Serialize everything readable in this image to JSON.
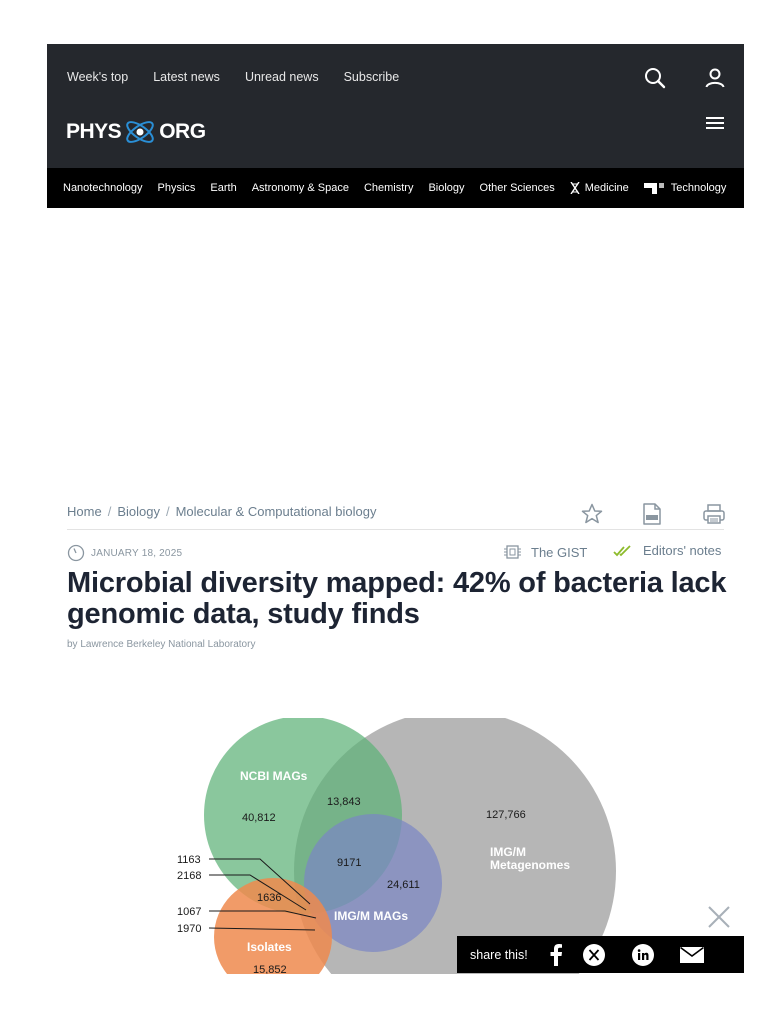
{
  "header": {
    "top_links": [
      "Week's top",
      "Latest news",
      "Unread news",
      "Subscribe"
    ],
    "logo_left": "PHYS",
    "logo_right": "ORG"
  },
  "categories": [
    "Nanotechnology",
    "Physics",
    "Earth",
    "Astronomy & Space",
    "Chemistry",
    "Biology",
    "Other Sciences",
    "Medicine",
    "Technology"
  ],
  "breadcrumb": [
    "Home",
    "Biology",
    "Molecular & Computational biology"
  ],
  "article": {
    "date": "JANUARY 18, 2025",
    "gist_label": "The GIST",
    "editors_label": "Editors' notes",
    "title": "Microbial diversity mapped: 42% of bacteria lack genomic data, study finds",
    "byline": "by Lawrence Berkeley National Laboratory"
  },
  "figure": {
    "set_labels": {
      "ncbi": "NCBI MAGs",
      "imgm_meta_1": "IMG/M",
      "imgm_meta_2": "Metagenomes",
      "imgm_mags": "IMG/M MAGs",
      "isolates": "Isolates"
    },
    "values": {
      "ncbi_only": "40,812",
      "ncbi_meta": "13,843",
      "meta_only": "127,766",
      "center": "9171",
      "mags_meta": "24,611",
      "iso_mags_meta": "1636",
      "isolates_only": "15,852",
      "c1163": "1163",
      "c2168": "2168",
      "c1067": "1067",
      "c1970": "1970"
    }
  },
  "share": {
    "label": "share this!"
  },
  "colors": {
    "header_bg": "#25282d",
    "nav_bg": "#000000",
    "ncbi": "#5db277",
    "meta": "#a9a9a9",
    "mags": "#7a86c4",
    "isolates": "#ef8a4e",
    "editors_check": "#8dbb2c"
  }
}
